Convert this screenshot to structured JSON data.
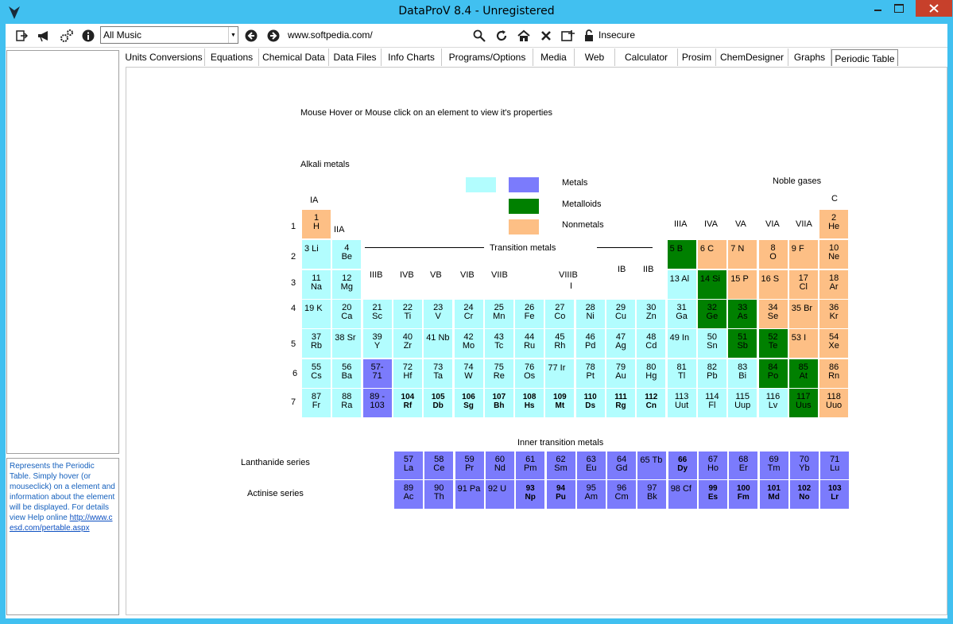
{
  "window": {
    "title": "DataProV 8.4 - Unregistered"
  },
  "toolbar": {
    "dropdown_value": "All Music",
    "url": "www.softpedia.com/",
    "security": "Insecure"
  },
  "tabs": [
    "Units Conversions",
    "Equations",
    "Chemical Data",
    "Data Files",
    "Info Charts",
    "Programs/Options",
    "Media",
    "Web",
    "Calculator",
    "Prosim",
    "ChemDesigner",
    "Graphs",
    "Periodic Table"
  ],
  "active_tab": "Periodic Table",
  "sidebar": {
    "info_text": "Represents the Periodic Table. Simply hover (or mouseclick) on a element and information about the element will be displayed. For details view Help online",
    "link": "http://www.cesd.com/pertable.aspx"
  },
  "periodic": {
    "instruction": "Mouse Hover or Mouse click on an element to view it's properties",
    "alkali_label": "Alkali metals",
    "noble_label": "Noble gases",
    "transition_label": "Transition metals",
    "inner_label": "Inner transition metals",
    "lanthanide_label": "Lanthanide series",
    "actinide_label": "Actinise series",
    "legend": {
      "metals": "Metals",
      "metalloids": "Metalloids",
      "nonmetals": "Nonmetals"
    },
    "colors": {
      "metal": "#b2fdfe",
      "series": "#7b7bfc",
      "metalloid": "#008000",
      "nonmetal": "#fdbf85"
    },
    "group_labels": {
      "IA": "IA",
      "IIA": "IIA",
      "IIIB": "IIIB",
      "IVB": "IVB",
      "VB": "VB",
      "VIB": "VIB",
      "VIIB": "VIIB",
      "VIIIB": "VIIIB",
      "VIIIB_2": "I",
      "IB": "IB",
      "IIB": "IIB",
      "IIIA": "IIIA",
      "IVA": "IVA",
      "VA": "VA",
      "VIA": "VIA",
      "VIIA": "VIIA",
      "C": "C"
    },
    "periods": [
      "1",
      "2",
      "3",
      "4",
      "5",
      "6",
      "7"
    ],
    "elements": [
      {
        "z": "1",
        "s": "H",
        "c": "nonmetal"
      },
      {
        "z": "2",
        "s": "He",
        "c": "nonmetal"
      },
      {
        "z": "3",
        "s": "Li",
        "c": "metal",
        "one": true
      },
      {
        "z": "4",
        "s": "Be",
        "c": "metal"
      },
      {
        "z": "5",
        "s": "B",
        "c": "metalloid",
        "one": true
      },
      {
        "z": "6",
        "s": "C",
        "c": "nonmetal",
        "one": true
      },
      {
        "z": "7",
        "s": "N",
        "c": "nonmetal",
        "one": true
      },
      {
        "z": "8",
        "s": "O",
        "c": "nonmetal"
      },
      {
        "z": "9",
        "s": "F",
        "c": "nonmetal",
        "one": true
      },
      {
        "z": "10",
        "s": "Ne",
        "c": "nonmetal"
      },
      {
        "z": "11",
        "s": "Na",
        "c": "metal"
      },
      {
        "z": "12",
        "s": "Mg",
        "c": "metal"
      },
      {
        "z": "13",
        "s": "Al",
        "c": "metal",
        "one": true
      },
      {
        "z": "14",
        "s": "Si",
        "c": "metalloid",
        "one": true
      },
      {
        "z": "15",
        "s": "P",
        "c": "nonmetal",
        "one": true
      },
      {
        "z": "16",
        "s": "S",
        "c": "nonmetal",
        "one": true
      },
      {
        "z": "17",
        "s": "Cl",
        "c": "nonmetal"
      },
      {
        "z": "18",
        "s": "Ar",
        "c": "nonmetal"
      },
      {
        "z": "19",
        "s": "K",
        "c": "metal",
        "one": true
      },
      {
        "z": "20",
        "s": "Ca",
        "c": "metal"
      },
      {
        "z": "21",
        "s": "Sc",
        "c": "metal"
      },
      {
        "z": "22",
        "s": "Ti",
        "c": "metal"
      },
      {
        "z": "23",
        "s": "V",
        "c": "metal"
      },
      {
        "z": "24",
        "s": "Cr",
        "c": "metal"
      },
      {
        "z": "25",
        "s": "Mn",
        "c": "metal"
      },
      {
        "z": "26",
        "s": "Fe",
        "c": "metal"
      },
      {
        "z": "27",
        "s": "Co",
        "c": "metal"
      },
      {
        "z": "28",
        "s": "Ni",
        "c": "metal"
      },
      {
        "z": "29",
        "s": "Cu",
        "c": "metal"
      },
      {
        "z": "30",
        "s": "Zn",
        "c": "metal"
      },
      {
        "z": "31",
        "s": "Ga",
        "c": "metal"
      },
      {
        "z": "32",
        "s": "Ge",
        "c": "metalloid"
      },
      {
        "z": "33",
        "s": "As",
        "c": "metalloid"
      },
      {
        "z": "34",
        "s": "Se",
        "c": "nonmetal"
      },
      {
        "z": "35",
        "s": "Br",
        "c": "nonmetal",
        "one": true
      },
      {
        "z": "36",
        "s": "Kr",
        "c": "nonmetal"
      },
      {
        "z": "37",
        "s": "Rb",
        "c": "metal"
      },
      {
        "z": "38",
        "s": "Sr",
        "c": "metal",
        "one": true
      },
      {
        "z": "39",
        "s": "Y",
        "c": "metal"
      },
      {
        "z": "40",
        "s": "Zr",
        "c": "metal"
      },
      {
        "z": "41",
        "s": "Nb",
        "c": "metal",
        "one": true
      },
      {
        "z": "42",
        "s": "Mo",
        "c": "metal"
      },
      {
        "z": "43",
        "s": "Tc",
        "c": "metal"
      },
      {
        "z": "44",
        "s": "Ru",
        "c": "metal"
      },
      {
        "z": "45",
        "s": "Rh",
        "c": "metal"
      },
      {
        "z": "46",
        "s": "Pd",
        "c": "metal"
      },
      {
        "z": "47",
        "s": "Ag",
        "c": "metal"
      },
      {
        "z": "48",
        "s": "Cd",
        "c": "metal"
      },
      {
        "z": "49",
        "s": "In",
        "c": "metal",
        "one": true
      },
      {
        "z": "50",
        "s": "Sn",
        "c": "metal"
      },
      {
        "z": "51",
        "s": "Sb",
        "c": "metalloid"
      },
      {
        "z": "52",
        "s": "Te",
        "c": "metalloid"
      },
      {
        "z": "53",
        "s": "I",
        "c": "nonmetal",
        "one": true
      },
      {
        "z": "54",
        "s": "Xe",
        "c": "nonmetal"
      },
      {
        "z": "55",
        "s": "Cs",
        "c": "metal"
      },
      {
        "z": "56",
        "s": "Ba",
        "c": "metal"
      },
      {
        "z": "57-",
        "s": "71",
        "c": "series"
      },
      {
        "z": "72",
        "s": "Hf",
        "c": "metal"
      },
      {
        "z": "73",
        "s": "Ta",
        "c": "metal"
      },
      {
        "z": "74",
        "s": "W",
        "c": "metal"
      },
      {
        "z": "75",
        "s": "Re",
        "c": "metal"
      },
      {
        "z": "76",
        "s": "Os",
        "c": "metal"
      },
      {
        "z": "77",
        "s": "Ir",
        "c": "metal",
        "one": true
      },
      {
        "z": "78",
        "s": "Pt",
        "c": "metal"
      },
      {
        "z": "79",
        "s": "Au",
        "c": "metal"
      },
      {
        "z": "80",
        "s": "Hg",
        "c": "metal"
      },
      {
        "z": "81",
        "s": "Tl",
        "c": "metal"
      },
      {
        "z": "82",
        "s": "Pb",
        "c": "metal"
      },
      {
        "z": "83",
        "s": "Bi",
        "c": "metal"
      },
      {
        "z": "84",
        "s": "Po",
        "c": "metalloid"
      },
      {
        "z": "85",
        "s": "At",
        "c": "metalloid"
      },
      {
        "z": "86",
        "s": "Rn",
        "c": "nonmetal"
      },
      {
        "z": "87",
        "s": "Fr",
        "c": "metal"
      },
      {
        "z": "88",
        "s": "Ra",
        "c": "metal"
      },
      {
        "z": "89 -",
        "s": "103",
        "c": "series"
      },
      {
        "z": "104",
        "s": "Rf",
        "c": "metal",
        "bold": true
      },
      {
        "z": "105",
        "s": "Db",
        "c": "metal",
        "bold": true
      },
      {
        "z": "106",
        "s": "Sg",
        "c": "metal",
        "bold": true
      },
      {
        "z": "107",
        "s": "Bh",
        "c": "metal",
        "bold": true
      },
      {
        "z": "108",
        "s": "Hs",
        "c": "metal",
        "bold": true
      },
      {
        "z": "109",
        "s": "Mt",
        "c": "metal",
        "bold": true
      },
      {
        "z": "110",
        "s": "Ds",
        "c": "metal",
        "bold": true
      },
      {
        "z": "111",
        "s": "Rg",
        "c": "metal",
        "bold": true
      },
      {
        "z": "112",
        "s": "Cn",
        "c": "metal",
        "bold": true
      },
      {
        "z": "113",
        "s": "Uut",
        "c": "metal"
      },
      {
        "z": "114",
        "s": "Fl",
        "c": "metal"
      },
      {
        "z": "115",
        "s": "Uup",
        "c": "metal"
      },
      {
        "z": "116",
        "s": "Lv",
        "c": "metal"
      },
      {
        "z": "117",
        "s": "Uus",
        "c": "metalloid"
      },
      {
        "z": "118",
        "s": "Uuo",
        "c": "nonmetal"
      }
    ],
    "lanthanides": [
      {
        "z": "57",
        "s": "La"
      },
      {
        "z": "58",
        "s": "Ce"
      },
      {
        "z": "59",
        "s": "Pr"
      },
      {
        "z": "60",
        "s": "Nd"
      },
      {
        "z": "61",
        "s": "Pm"
      },
      {
        "z": "62",
        "s": "Sm"
      },
      {
        "z": "63",
        "s": "Eu"
      },
      {
        "z": "64",
        "s": "Gd"
      },
      {
        "z": "65",
        "s": "Tb",
        "one": true
      },
      {
        "z": "66",
        "s": "Dy",
        "bold": true
      },
      {
        "z": "67",
        "s": "Ho"
      },
      {
        "z": "68",
        "s": "Er"
      },
      {
        "z": "69",
        "s": "Tm"
      },
      {
        "z": "70",
        "s": "Yb"
      },
      {
        "z": "71",
        "s": "Lu"
      }
    ],
    "actinides": [
      {
        "z": "89",
        "s": "Ac"
      },
      {
        "z": "90",
        "s": "Th"
      },
      {
        "z": "91",
        "s": "Pa",
        "one": true
      },
      {
        "z": "92",
        "s": "U",
        "one": true
      },
      {
        "z": "93",
        "s": "Np",
        "bold": true
      },
      {
        "z": "94",
        "s": "Pu",
        "bold": true
      },
      {
        "z": "95",
        "s": "Am"
      },
      {
        "z": "96",
        "s": "Cm"
      },
      {
        "z": "97",
        "s": "Bk"
      },
      {
        "z": "98",
        "s": "Cf",
        "one": true
      },
      {
        "z": "99",
        "s": "Es",
        "bold": true
      },
      {
        "z": "100",
        "s": "Fm",
        "bold": true
      },
      {
        "z": "101",
        "s": "Md",
        "bold": true
      },
      {
        "z": "102",
        "s": "No",
        "bold": true
      },
      {
        "z": "103",
        "s": "Lr",
        "bold": true
      }
    ]
  }
}
